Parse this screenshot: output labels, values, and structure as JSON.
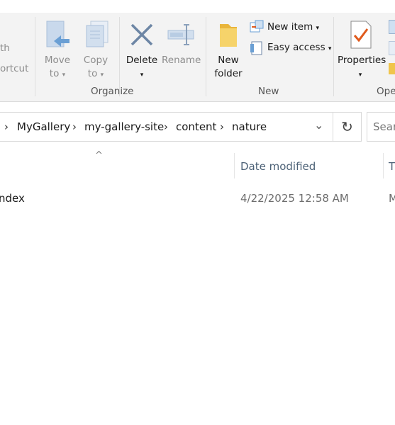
{
  "ribbon": {
    "clipboard_partial": {
      "line1": "th",
      "line2": "ortcut"
    },
    "move_to": {
      "line1": "Move",
      "line2": "to"
    },
    "copy_to": {
      "line1": "Copy",
      "line2": "to"
    },
    "delete": "Delete",
    "rename": "Rename",
    "organize_group": "Organize",
    "new_folder": {
      "line1": "New",
      "line2": "folder"
    },
    "new_item": "New item",
    "easy_access": "Easy access",
    "new_group": "New",
    "properties": "Properties",
    "open_group": "Ope",
    "caret": "▾",
    "accent_blue": "#6a9fd4",
    "folder_yellow": "#f0c54c",
    "check_orange": "#e05a1c"
  },
  "address": {
    "crumbs": [
      "MyGallery",
      "my-gallery-site",
      "content",
      "nature"
    ],
    "chevron": "›",
    "dropdown": "⌄",
    "refresh": "↻"
  },
  "search": {
    "placeholder": "Search"
  },
  "columns": {
    "sort_indicator": "^",
    "date_modified": "Date modified",
    "type_partial": "T"
  },
  "rows": [
    {
      "name": "ndex",
      "date": "4/22/2025 12:58 AM",
      "type_partial": "M"
    }
  ]
}
